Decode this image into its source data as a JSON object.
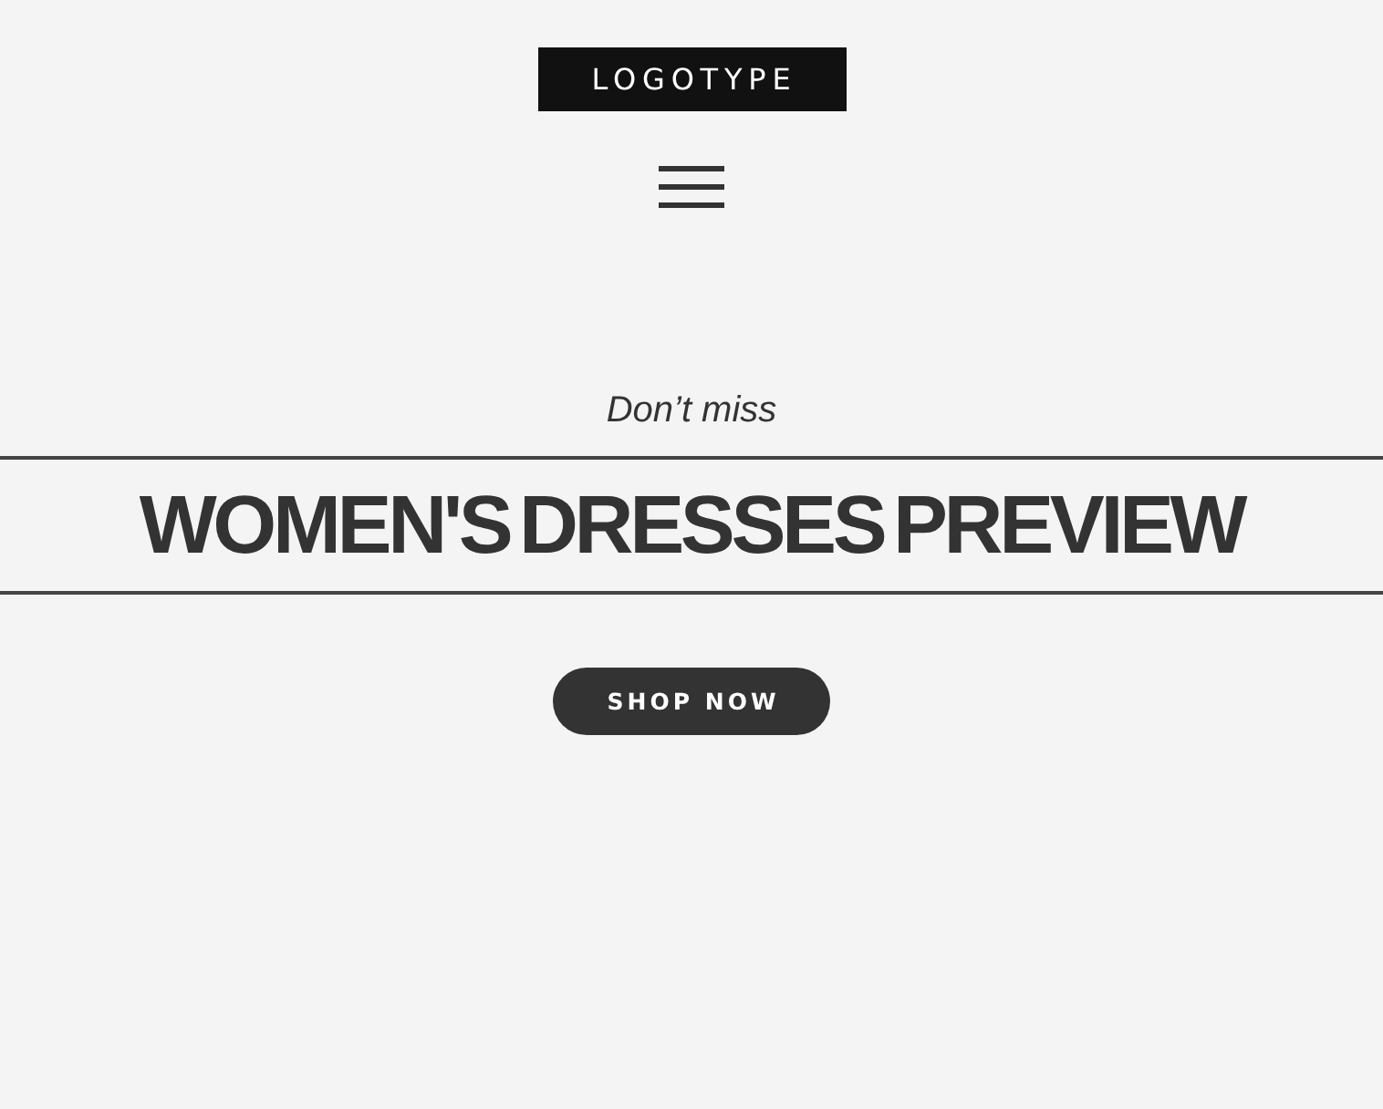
{
  "header": {
    "logo": "LOGOTYPE"
  },
  "hero": {
    "eyebrow": "Don’t miss",
    "title": "WOMEN'S DRESSES PREVIEW",
    "button": "SHOP NOW"
  }
}
